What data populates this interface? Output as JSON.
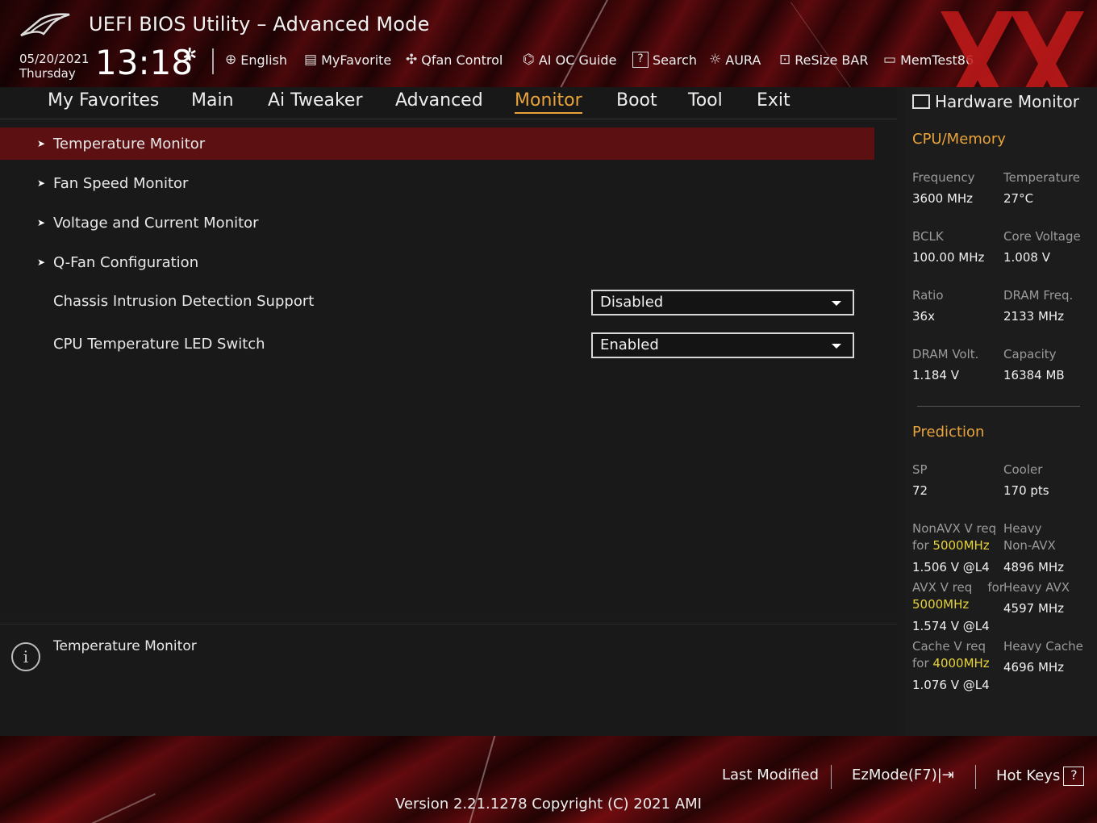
{
  "header": {
    "title": "UEFI BIOS Utility – Advanced Mode",
    "date": "05/20/2021",
    "weekday": "Thursday",
    "time": "13:18",
    "tools": [
      {
        "label": "English",
        "icon": "globe-icon"
      },
      {
        "label": "MyFavorite",
        "icon": "favorite-icon"
      },
      {
        "label": "Qfan Control",
        "icon": "fan-icon"
      },
      {
        "label": "AI OC Guide",
        "icon": "chip-icon"
      },
      {
        "label": "Search",
        "icon": "search-icon"
      },
      {
        "label": "AURA",
        "icon": "aura-icon"
      },
      {
        "label": "ReSize BAR",
        "icon": "resize-bar-icon"
      },
      {
        "label": "MemTest86",
        "icon": "memory-icon"
      }
    ]
  },
  "nav": {
    "tabs": [
      "My Favorites",
      "Main",
      "Ai Tweaker",
      "Advanced",
      "Monitor",
      "Boot",
      "Tool",
      "Exit"
    ],
    "active": "Monitor"
  },
  "menu": {
    "submenus": [
      "Temperature Monitor",
      "Fan Speed Monitor",
      "Voltage and Current Monitor",
      "Q-Fan Configuration"
    ],
    "settings": [
      {
        "label": "Chassis Intrusion Detection Support",
        "value": "Disabled"
      },
      {
        "label": "CPU Temperature LED Switch",
        "value": "Enabled"
      }
    ]
  },
  "help": {
    "text": "Temperature Monitor"
  },
  "hw_monitor": {
    "title": "Hardware Monitor",
    "cpu_memory": {
      "heading": "CPU/Memory",
      "frequency_label": "Frequency",
      "frequency": "3600 MHz",
      "temperature_label": "Temperature",
      "temperature": "27°C",
      "bclk_label": "BCLK",
      "bclk": "100.00 MHz",
      "core_voltage_label": "Core Voltage",
      "core_voltage": "1.008 V",
      "ratio_label": "Ratio",
      "ratio": "36x",
      "dram_freq_label": "DRAM Freq.",
      "dram_freq": "2133 MHz",
      "dram_volt_label": "DRAM Volt.",
      "dram_volt": "1.184 V",
      "capacity_label": "Capacity",
      "capacity": "16384 MB"
    },
    "prediction": {
      "heading": "Prediction",
      "sp_label": "SP",
      "sp": "72",
      "cooler_label": "Cooler",
      "cooler": "170 pts",
      "nonavx_label_a": "NonAVX V req",
      "nonavx_label_b": "for",
      "nonavx_freq": "5000MHz",
      "nonavx_value": "1.506 V @L4",
      "heavy_nonavx_label_a": "Heavy",
      "heavy_nonavx_label_b": "Non-AVX",
      "heavy_nonavx_value": "4896 MHz",
      "avx_label_a": "AVX V req",
      "avx_label_b": "for",
      "avx_freq": "5000MHz",
      "avx_value": "1.574 V @L4",
      "heavy_avx_label": "Heavy AVX",
      "heavy_avx_value": "4597 MHz",
      "cache_label_a": "Cache V req",
      "cache_label_b": "for",
      "cache_freq": "4000MHz",
      "cache_value": "1.076 V @L4",
      "heavy_cache_label": "Heavy Cache",
      "heavy_cache_value": "4696 MHz"
    }
  },
  "footer": {
    "last_modified": "Last Modified",
    "ezmode": "EzMode(F7)|",
    "hotkeys": "Hot Keys",
    "hotkeys_key": "?",
    "version": "Version 2.21.1278 Copyright (C) 2021 AMI"
  },
  "colors": {
    "accent": "#e8a43a",
    "selected_row": "#5c1012",
    "highlight": "#e6d33b"
  }
}
